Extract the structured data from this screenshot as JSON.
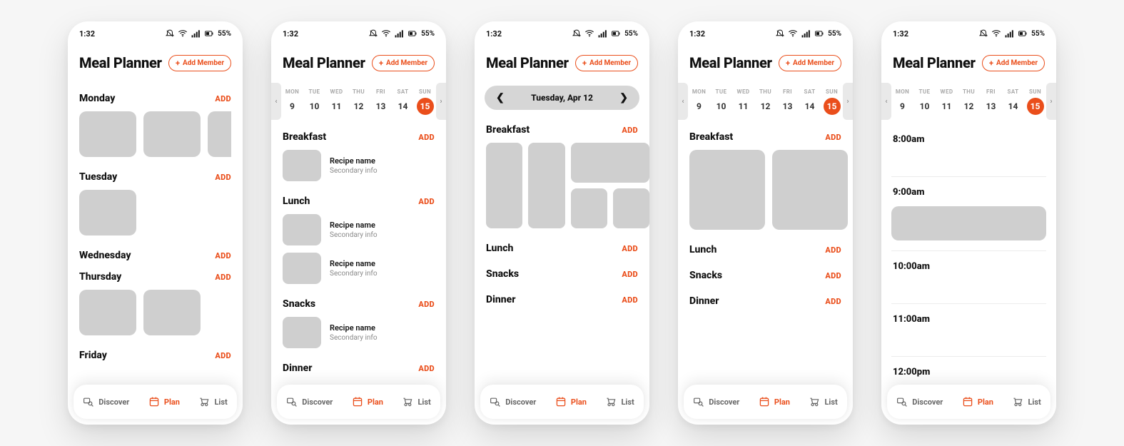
{
  "status": {
    "time": "1:32",
    "battery_text": "55%"
  },
  "header": {
    "title": "Meal Planner",
    "add_member_label": "Add Member"
  },
  "week": {
    "days": [
      {
        "label": "MON",
        "num": "9"
      },
      {
        "label": "TUE",
        "num": "10"
      },
      {
        "label": "WED",
        "num": "11"
      },
      {
        "label": "THU",
        "num": "12"
      },
      {
        "label": "FRI",
        "num": "13"
      },
      {
        "label": "SAT",
        "num": "14"
      },
      {
        "label": "SUN",
        "num": "15"
      }
    ],
    "selected_index": 6
  },
  "actions": {
    "add": "ADD"
  },
  "recipe": {
    "name": "Recipe name",
    "secondary": "Secondary info"
  },
  "meals": {
    "breakfast": "Breakfast",
    "lunch": "Lunch",
    "snacks": "Snacks",
    "dinner": "Dinner"
  },
  "nav": {
    "discover": "Discover",
    "plan": "Plan",
    "list": "List",
    "active": "plan"
  },
  "screen1": {
    "days": [
      "Monday",
      "Tuesday",
      "Wednesday",
      "Thursday",
      "Friday"
    ]
  },
  "screen3": {
    "date_label": "Tuesday, Apr 12"
  },
  "screen5": {
    "hours": [
      "8:00am",
      "9:00am",
      "10:00am",
      "11:00am",
      "12:00pm"
    ],
    "tile_index": 1
  }
}
